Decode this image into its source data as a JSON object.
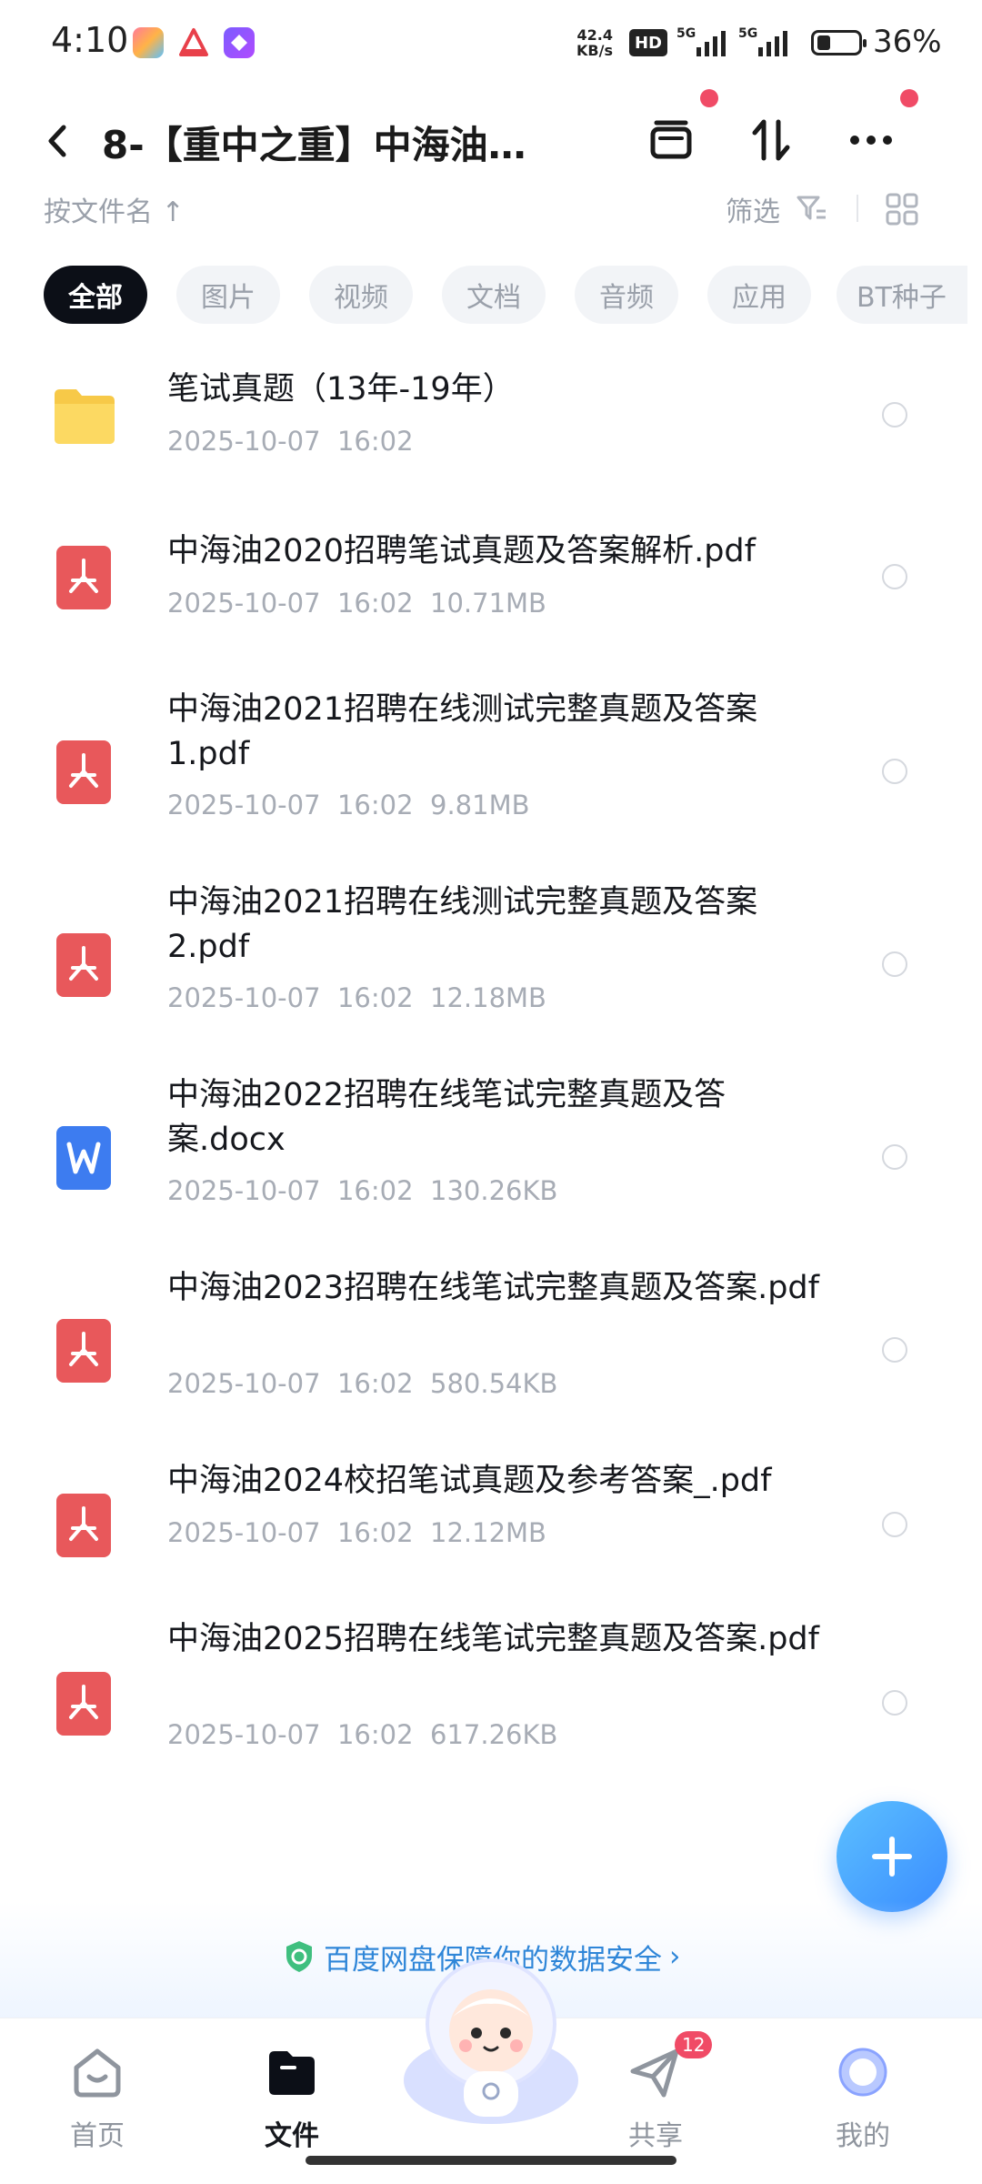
{
  "status_bar": {
    "time": "4:10",
    "net_speed_value": "42.4",
    "net_speed_unit": "KB/s",
    "hd_label": "HD",
    "signal1_label": "5G",
    "signal2_label": "5G",
    "battery_percent": "36%"
  },
  "header": {
    "title": "8-【重中之重】中海油笔...",
    "back_icon": "chevron-left-icon",
    "actions": [
      "archive-icon",
      "transfer-icon",
      "more-icon"
    ]
  },
  "sort_row": {
    "sort_label": "按文件名 ↑",
    "filter_label": "筛选"
  },
  "chips": [
    {
      "label": "全部",
      "active": true
    },
    {
      "label": "图片",
      "active": false
    },
    {
      "label": "视频",
      "active": false
    },
    {
      "label": "文档",
      "active": false
    },
    {
      "label": "音频",
      "active": false
    },
    {
      "label": "应用",
      "active": false
    },
    {
      "label": "BT种子",
      "active": false
    }
  ],
  "files": [
    {
      "type": "folder",
      "name": "笔试真题（13年-19年）",
      "date": "2025-10-07",
      "time": "16:02",
      "size": ""
    },
    {
      "type": "pdf",
      "name": "中海油2020招聘笔试真题及答案解析.pdf",
      "date": "2025-10-07",
      "time": "16:02",
      "size": "10.71MB"
    },
    {
      "type": "pdf",
      "name": "中海油2021招聘在线测试完整真题及答案1.pdf",
      "date": "2025-10-07",
      "time": "16:02",
      "size": "9.81MB"
    },
    {
      "type": "pdf",
      "name": "中海油2021招聘在线测试完整真题及答案2.pdf",
      "date": "2025-10-07",
      "time": "16:02",
      "size": "12.18MB"
    },
    {
      "type": "docx",
      "name": "中海油2022招聘在线笔试完整真题及答案.docx",
      "date": "2025-10-07",
      "time": "16:02",
      "size": "130.26KB"
    },
    {
      "type": "pdf",
      "name": "中海油2023招聘在线笔试完整真题及答案.pdf",
      "date": "2025-10-07",
      "time": "16:02",
      "size": "580.54KB"
    },
    {
      "type": "pdf",
      "name": "中海油2024校招笔试真题及参考答案_.pdf",
      "date": "2025-10-07",
      "time": "16:02",
      "size": "12.12MB"
    },
    {
      "type": "pdf",
      "name": "中海油2025招聘在线笔试完整真题及答案.pdf",
      "date": "2025-10-07",
      "time": "16:02",
      "size": "617.26KB"
    }
  ],
  "safety_banner": {
    "text": "百度网盘保障你的数据安全",
    "arrow": "›"
  },
  "bottom_nav": [
    {
      "label": "首页",
      "icon": "home-icon",
      "active": false
    },
    {
      "label": "文件",
      "icon": "folder-icon",
      "active": true
    },
    {
      "label": "共享",
      "icon": "share-icon",
      "active": false,
      "badge": "12"
    },
    {
      "label": "我的",
      "icon": "profile-icon",
      "active": false
    }
  ],
  "colors": {
    "accent_blue": "#3a8cff",
    "pdf_red": "#e8585b",
    "word_blue": "#3d7cf0",
    "folder_yellow": "#fcd457",
    "badge_red": "#f04b66"
  }
}
